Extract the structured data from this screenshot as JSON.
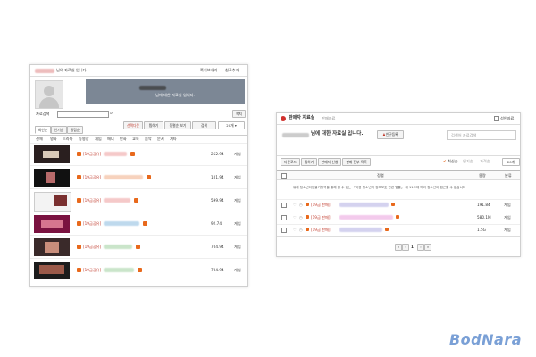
{
  "left": {
    "header_title": "님의 자료실 입니다",
    "header_links": [
      "쪽지보내기",
      "친구추가"
    ],
    "banner_text": "님에 대한 자료실 입니다.",
    "search_label": "자료검색",
    "mail_button": "쪽지",
    "action_buttons": [
      "선택다운",
      "찜하기",
      "정렬순 보기",
      "검색"
    ],
    "tabs": [
      "최신순",
      "인기순",
      "평점순"
    ],
    "categories": [
      "전체",
      "영화",
      "드라마",
      "동영상",
      "게임",
      "애니",
      "만화",
      "교육",
      "음악",
      "문서",
      "기타"
    ],
    "rows": [
      {
        "tag": "[19금공유]",
        "size": "252.94",
        "type": "게임"
      },
      {
        "tag": "[19금공유]",
        "size": "101.94",
        "type": "게임"
      },
      {
        "tag": "[19금공유]",
        "size": "599.94",
        "type": "게임"
      },
      {
        "tag": "[19금공유]",
        "size": "92.74",
        "type": "게임"
      },
      {
        "tag": "[19금공유]",
        "size": "704.94",
        "type": "게임"
      },
      {
        "tag": "[19금공유]",
        "size": "704.94",
        "type": "게임"
      }
    ]
  },
  "right": {
    "title": "판매자 자료실",
    "breadcrumb": "판매자료",
    "checkbox_label": "성인자료",
    "subtitle": "님에 대한 자료실 입니다.",
    "friend_button": "친구등록",
    "search_placeholder": "검색어 자료검색",
    "toolbar_buttons": [
      "다운로드",
      "찜하기",
      "판매자 신청",
      "판매 전부 목록"
    ],
    "sort_options": [
      "최신순",
      "인기순",
      "가격순"
    ],
    "per_page": "20개",
    "columns": [
      "정렬",
      "용량",
      "분류"
    ],
    "notice": "유해 청소년이용불가항목을 통해 볼 수 있는 「이용 청소년의 정보보호 관련 법률」 제 11조에 따라 청소년이 접근할 수 없습니다",
    "rows": [
      {
        "tag": "[19금 판매]",
        "size": "191.84",
        "type": "게임"
      },
      {
        "tag": "[19금 판매]",
        "size": "580.1M",
        "type": "게임"
      },
      {
        "tag": "[19금 판매]",
        "size": "1.5G",
        "type": "게임"
      }
    ],
    "pager_current": "1"
  },
  "watermark": "BodNara",
  "colors": {
    "accent": "#e8691c",
    "title_red": "#d0312d",
    "tag_red": "#c0392b",
    "banner": "#7c8795",
    "watermark": "#7aa0d6"
  }
}
